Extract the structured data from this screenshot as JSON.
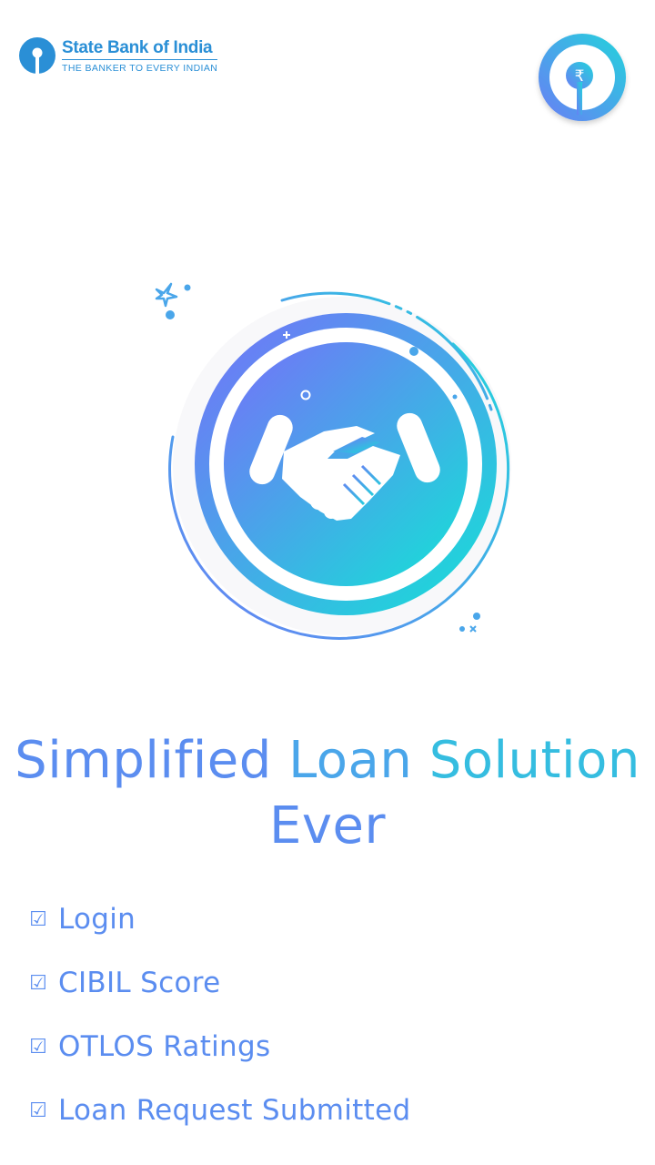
{
  "brand": {
    "name": "State Bank of India",
    "tagline": "THE BANKER TO EVERY INDIAN",
    "color": "#2a8fd6",
    "logo_icon": "sbi-keyhole-logo"
  },
  "app_logo": {
    "icon": "rupee-keyhole-logo",
    "symbol": "₹"
  },
  "hero": {
    "icon": "handshake-icon"
  },
  "headline": {
    "word1": "Simplified",
    "word2": "Loan",
    "word3": "Solution",
    "word4": "Ever"
  },
  "features": [
    {
      "check": "☑",
      "label": "Login"
    },
    {
      "check": "☑",
      "label": "CIBIL Score"
    },
    {
      "check": "☑",
      "label": "OTLOS Ratings"
    },
    {
      "check": "☑",
      "label": "Loan Request Submitted"
    }
  ],
  "colors": {
    "gradient_start": "#6a7ef5",
    "gradient_end": "#22d3dc",
    "text_blue": "#5b8df0"
  }
}
